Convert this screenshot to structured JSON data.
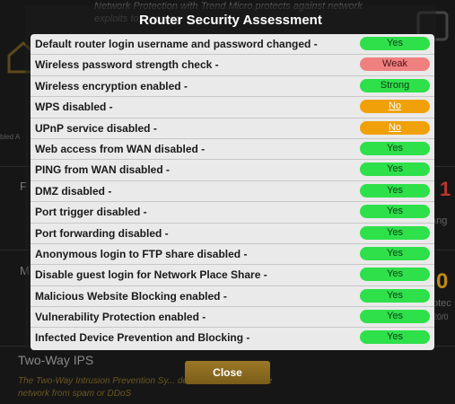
{
  "background": {
    "top_text": "Network Protection with Trend Micro protects against network exploits to... access.",
    "left_label": "bled A",
    "row1_letter": "F",
    "row2_letter": "M",
    "right_num1": "1",
    "right_txt1": "ang",
    "right_num2": "0",
    "right_txt2": "otec",
    "right_txt3": "20/0",
    "section_title": "Two-Way IPS",
    "section_desc": "The Two-Way Intrusion Prevention Sy... device connected to the network from spam or DDoS"
  },
  "modal": {
    "title": "Router Security Assessment",
    "close_label": "Close"
  },
  "checks": [
    {
      "label": "Default router login username and password changed -",
      "status": "Yes",
      "color": "green"
    },
    {
      "label": "Wireless password strength check -",
      "status": "Weak",
      "color": "red"
    },
    {
      "label": "Wireless encryption enabled -",
      "status": "Strong",
      "color": "green"
    },
    {
      "label": "WPS disabled -",
      "status": "No",
      "color": "orange"
    },
    {
      "label": "UPnP service disabled -",
      "status": "No",
      "color": "orange"
    },
    {
      "label": "Web access from WAN disabled -",
      "status": "Yes",
      "color": "green"
    },
    {
      "label": "PING from WAN disabled -",
      "status": "Yes",
      "color": "green"
    },
    {
      "label": "DMZ disabled -",
      "status": "Yes",
      "color": "green"
    },
    {
      "label": "Port trigger disabled -",
      "status": "Yes",
      "color": "green"
    },
    {
      "label": "Port forwarding disabled -",
      "status": "Yes",
      "color": "green"
    },
    {
      "label": "Anonymous login to FTP share disabled -",
      "status": "Yes",
      "color": "green"
    },
    {
      "label": "Disable guest login for Network Place Share -",
      "status": "Yes",
      "color": "green"
    },
    {
      "label": "Malicious Website Blocking enabled -",
      "status": "Yes",
      "color": "green"
    },
    {
      "label": "Vulnerability Protection enabled -",
      "status": "Yes",
      "color": "green"
    },
    {
      "label": "Infected Device Prevention and Blocking -",
      "status": "Yes",
      "color": "green"
    }
  ],
  "colors": {
    "green": "#2ee04a",
    "red": "#f08080",
    "orange": "#f0a10a",
    "accent": "#9b7826"
  }
}
